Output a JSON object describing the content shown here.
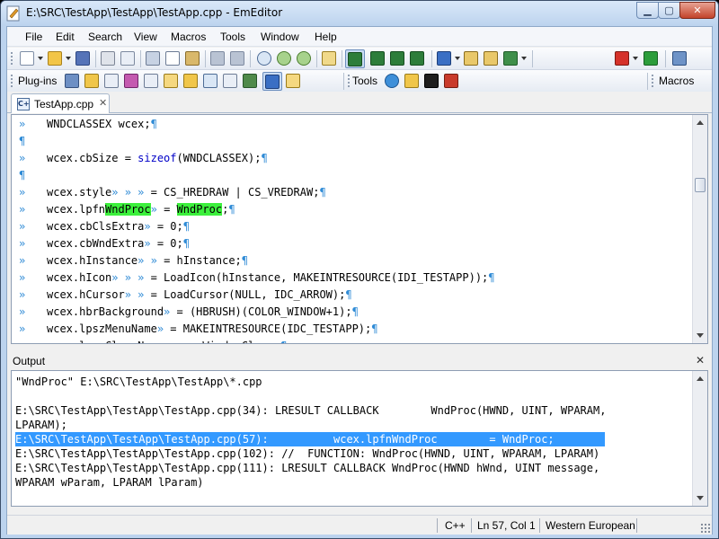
{
  "window": {
    "title": "E:\\SRC\\TestApp\\TestApp\\TestApp.cpp - EmEditor",
    "minimize_glyph": "▁",
    "maximize_glyph": "▢",
    "close_glyph": "✕"
  },
  "menu": {
    "items": [
      "File",
      "Edit",
      "Search",
      "View",
      "Macros",
      "Tools",
      "Window",
      "Help"
    ]
  },
  "toolbar2": {
    "plugins_label": "Plug-ins",
    "tools_label": "Tools",
    "macros_label": "Macros"
  },
  "tab": {
    "label": "TestApp.cpp",
    "icon_text": "C+",
    "close_glyph": "✕"
  },
  "editor": {
    "tab_mark": "»",
    "pilcrow": "¶",
    "lines": [
      {
        "pre": "WNDCLASSEX wcex;",
        "tabs": "",
        "post": ""
      },
      {
        "pre": "",
        "tabs": "",
        "post": "",
        "blank": true
      },
      {
        "pre": "wcex.cbSize = ",
        "kw": "sizeof",
        "kwpost": "(WNDCLASSEX);"
      },
      {
        "pre": "",
        "tabs": "",
        "post": "",
        "blank": true
      },
      {
        "pre": "wcex.style",
        "tabs": "» » »",
        "post": " = CS_HREDRAW | CS_VREDRAW;"
      },
      {
        "pre": "wcex.lpfn",
        "hl1": "WndProc",
        "tabs": "»",
        "post": " = ",
        "hl2": "WndProc",
        "post2": ";"
      },
      {
        "pre": "wcex.cbClsExtra",
        "tabs": "»",
        "post": " = 0;"
      },
      {
        "pre": "wcex.cbWndExtra",
        "tabs": "»",
        "post": " = 0;"
      },
      {
        "pre": "wcex.hInstance",
        "tabs": "» »",
        "post": " = hInstance;"
      },
      {
        "pre": "wcex.hIcon",
        "tabs": "» » »",
        "post": " = LoadIcon(hInstance, MAKEINTRESOURCE(IDI_TESTAPP));"
      },
      {
        "pre": "wcex.hCursor",
        "tabs": "» »",
        "post": " = LoadCursor(NULL, IDC_ARROW);"
      },
      {
        "pre": "wcex.hbrBackground",
        "tabs": "»",
        "post": " = (HBRUSH)(COLOR_WINDOW+1);"
      },
      {
        "pre": "wcex.lpszMenuName",
        "tabs": "»",
        "post": " = MAKEINTRESOURCE(IDC_TESTAPP);"
      },
      {
        "pre": "wcex.lpszClassName",
        "tabs": "»",
        "post": " = szWindowClass;"
      }
    ]
  },
  "output": {
    "title": "Output",
    "close_glyph": "✕",
    "lines": [
      "\"WndProc\" E:\\SRC\\TestApp\\TestApp\\*.cpp",
      "",
      "E:\\SRC\\TestApp\\TestApp\\TestApp.cpp(34): LRESULT CALLBACK        WndProc(HWND, UINT, WPARAM,",
      "LPARAM);",
      "E:\\SRC\\TestApp\\TestApp\\TestApp.cpp(57):          wcex.lpfnWndProc        = WndProc;",
      "E:\\SRC\\TestApp\\TestApp\\TestApp.cpp(102): //  FUNCTION: WndProc(HWND, UINT, WPARAM, LPARAM)",
      "E:\\SRC\\TestApp\\TestApp\\TestApp.cpp(111): LRESULT CALLBACK WndProc(HWND hWnd, UINT message,",
      "WPARAM wParam, LPARAM lParam)"
    ],
    "selected_index": 4
  },
  "status": {
    "language": "C++",
    "position": "Ln 57, Col 1",
    "encoding": "Western European"
  },
  "colors": {
    "highlight": "#3cf03c",
    "selection": "#3399ff",
    "keyword": "#0000c8",
    "marks": "#2f8bd6"
  }
}
